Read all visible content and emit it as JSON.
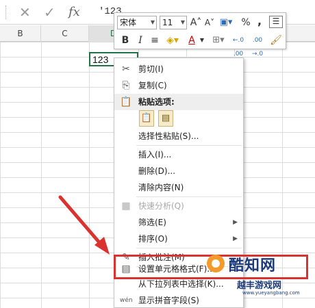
{
  "formula_bar": {
    "cancel_icon": "✕",
    "enter_icon": "✓",
    "fx_label": "fx",
    "value": "'123"
  },
  "columns": [
    "B",
    "C",
    "D"
  ],
  "active_cell": {
    "value": "123"
  },
  "mini_toolbar": {
    "font_name": "宋体",
    "font_size": "11",
    "grow_font": "A˄",
    "shrink_font": "A˅",
    "percent": "%",
    "comma": ",",
    "bold": "B",
    "italic": "I",
    "align": "≡",
    "font_color": "A",
    "decimal_increase": "←.0 .00",
    "decimal_decrease": ".00 →.0",
    "accent_color": "#d9322f"
  },
  "context_menu": {
    "items": [
      {
        "label": "剪切(I)",
        "icon": "✂"
      },
      {
        "label": "复制(C)",
        "icon": "⎘"
      },
      {
        "label": "粘贴选项:",
        "icon": "📋"
      },
      {
        "label": "选择性粘贴(S)...",
        "icon": ""
      },
      {
        "label": "插入(I)...",
        "icon": ""
      },
      {
        "label": "删除(D)...",
        "icon": ""
      },
      {
        "label": "清除内容(N)",
        "icon": ""
      },
      {
        "label": "快速分析(Q)",
        "icon": "▦"
      },
      {
        "label": "筛选(E)",
        "icon": ""
      },
      {
        "label": "排序(O)",
        "icon": ""
      },
      {
        "label": "插入批注(M)",
        "icon": "✎"
      },
      {
        "label": "设置单元格格式(F)...",
        "icon": "▤"
      },
      {
        "label": "从下拉列表中选择(K)...",
        "icon": ""
      },
      {
        "label": "显示拼音字段(S)",
        "icon": "wén"
      }
    ]
  },
  "watermark": {
    "name": "酷知网",
    "name2": "越丰游戏网",
    "url": "www.yueyangbang.com"
  },
  "colors": {
    "highlight": "#d9322f",
    "arrow": "#d9322f",
    "excel_green": "#217346"
  }
}
